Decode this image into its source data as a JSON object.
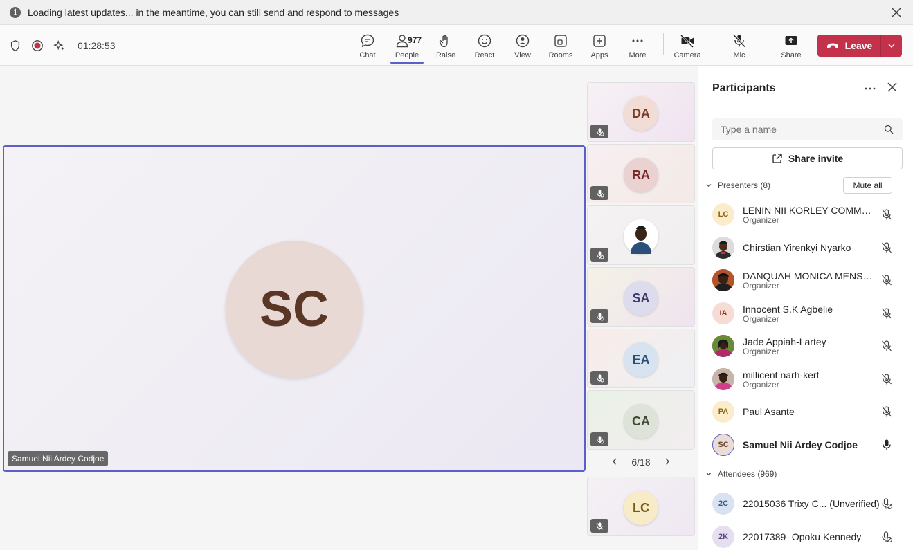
{
  "banner": {
    "message": "Loading latest updates... in the meantime, you can still send and respond to messages",
    "info_icon": "i"
  },
  "toolbar": {
    "timer": "01:28:53",
    "buttons": {
      "chat": "Chat",
      "people": "People",
      "people_count": "977",
      "raise": "Raise",
      "react": "React",
      "view": "View",
      "rooms": "Rooms",
      "apps": "Apps",
      "more": "More",
      "camera": "Camera",
      "mic": "Mic",
      "share": "Share",
      "leave": "Leave"
    }
  },
  "stage": {
    "initials": "SC",
    "name": "Samuel Nii Ardey Codjoe"
  },
  "tiles": [
    {
      "initials": "DA",
      "bg": "#f2ddd6",
      "fg": "#7a3b22"
    },
    {
      "initials": "RA",
      "bg": "#ebd2d2",
      "fg": "#7a2a2a"
    },
    {
      "initials": "",
      "bg": "#dfe6ee",
      "fg": "#333333",
      "photo": true
    },
    {
      "initials": "SA",
      "bg": "#dcdcec",
      "fg": "#3b3b6e"
    },
    {
      "initials": "EA",
      "bg": "#d7e3f1",
      "fg": "#2b4c74"
    },
    {
      "initials": "CA",
      "bg": "#dde3d8",
      "fg": "#3e4a33"
    },
    {
      "initials": "LC",
      "bg": "#f7ebc8",
      "fg": "#7a5a10"
    }
  ],
  "pager": {
    "label": "6/18"
  },
  "panel": {
    "title": "Participants",
    "search_placeholder": "Type a name",
    "share_invite": "Share invite",
    "mute_all": "Mute all",
    "presenters_label": "Presenters (8)",
    "attendees_label": "Attendees (969)",
    "presenters": [
      {
        "name": "LENIN NII KORLEY COMMOD...",
        "role": "Organizer",
        "initials": "LC",
        "bg": "#fbeccb",
        "fg": "#8a6512"
      },
      {
        "name": "Chirstian Yirenkyi Nyarko",
        "role": "",
        "initials": "",
        "photo": "man"
      },
      {
        "name": "DANQUAH MONICA MENSAH",
        "role": "Organizer",
        "initials": "",
        "photo": "woman1"
      },
      {
        "name": "Innocent S.K Agbelie",
        "role": "Organizer",
        "initials": "IA",
        "bg": "#f6dcd4",
        "fg": "#8b3a22"
      },
      {
        "name": "Jade Appiah-Lartey",
        "role": "Organizer",
        "initials": "",
        "photo": "woman2"
      },
      {
        "name": "millicent narh-kert",
        "role": "Organizer",
        "initials": "",
        "photo": "woman3"
      },
      {
        "name": "Paul Asante",
        "role": "",
        "initials": "PA",
        "bg": "#fbeccb",
        "fg": "#8a6512"
      },
      {
        "name": "Samuel Nii Ardey Codjoe",
        "role": "",
        "initials": "SC",
        "bg": "#ecdcd6",
        "fg": "#6b4333",
        "self": true
      }
    ],
    "attendees": [
      {
        "name": "22015036 Trixy C... (Unverified)",
        "initials": "2C",
        "bg": "#d8e2f1",
        "fg": "#3a5a86"
      },
      {
        "name": "22017389- Opoku Kennedy",
        "initials": "2K",
        "bg": "#e5dff0",
        "fg": "#5a4a80"
      }
    ]
  },
  "colors": {
    "accent": "#5b5fc7",
    "leave": "#c4314b"
  }
}
